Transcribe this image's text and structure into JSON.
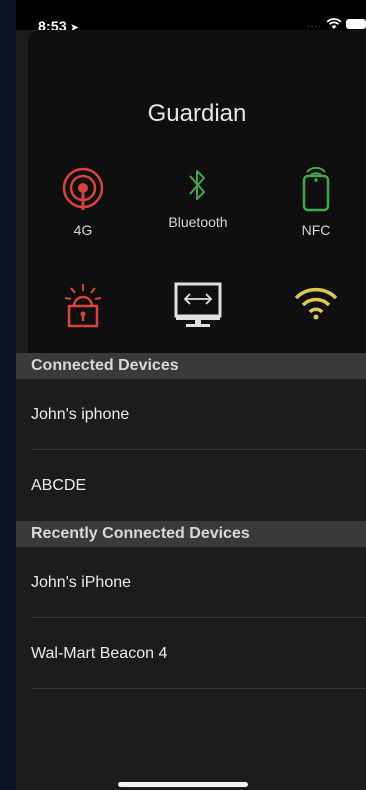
{
  "status_bar": {
    "time": "8:53",
    "location_icon": "location-arrow-icon",
    "signal_dots": "....",
    "wifi_icon": "wifi-icon",
    "battery_icon": "battery-icon"
  },
  "card": {
    "title": "Guardian",
    "features": [
      {
        "label": "4G",
        "icon": "cellular-tower-icon",
        "color": "#d9433a"
      },
      {
        "label": "Bluetooth",
        "icon": "bluetooth-icon",
        "color": "#3fa84a"
      },
      {
        "label": "NFC",
        "icon": "nfc-phone-icon",
        "color": "#3fa84a"
      },
      {
        "label": "",
        "icon": "alarm-lock-icon",
        "color": "#d9433a"
      },
      {
        "label": "",
        "icon": "remote-desktop-icon",
        "color": "#e0e0e0"
      },
      {
        "label": "",
        "icon": "wifi-icon",
        "color": "#e0c94a"
      }
    ]
  },
  "connected": {
    "header": "Connected Devices",
    "items": [
      "John's iphone",
      "ABCDE"
    ]
  },
  "recent": {
    "header": "Recently Connected Devices",
    "items": [
      "John's iPhone",
      "Wal-Mart Beacon 4"
    ]
  }
}
